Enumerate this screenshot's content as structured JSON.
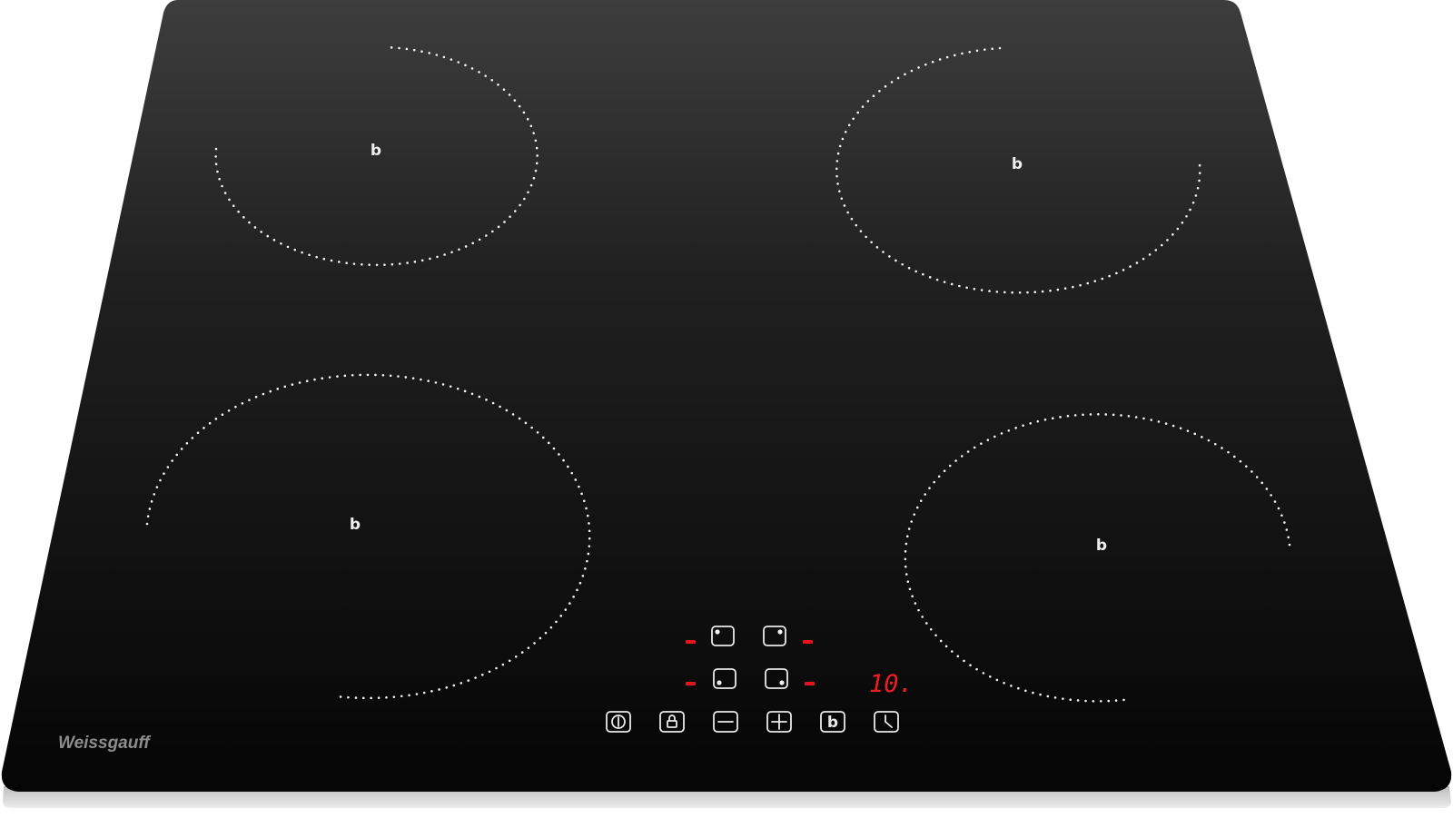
{
  "brand": "Weissgauff",
  "display": {
    "timer": "10."
  },
  "zones": [
    {
      "id": "rear-left",
      "icon": "b",
      "icon_name": "booster-icon"
    },
    {
      "id": "rear-right",
      "icon": "b",
      "icon_name": "booster-icon"
    },
    {
      "id": "front-left",
      "icon": "b",
      "icon_name": "booster-icon"
    },
    {
      "id": "front-right",
      "icon": "b",
      "icon_name": "booster-icon"
    }
  ],
  "controls": [
    {
      "name": "power-button",
      "icon": "power-icon"
    },
    {
      "name": "lock-button",
      "icon": "lock-icon"
    },
    {
      "name": "minus-button",
      "icon": "minus-icon"
    },
    {
      "name": "plus-button",
      "icon": "plus-icon"
    },
    {
      "name": "booster-button",
      "icon": "booster-icon",
      "label": "b"
    },
    {
      "name": "timer-button",
      "icon": "clock-icon"
    }
  ],
  "colors": {
    "glass": "#0b0b0b",
    "indicator": "#e4141c",
    "print": "#f2f2f2",
    "brand": "#8d8d8d"
  }
}
